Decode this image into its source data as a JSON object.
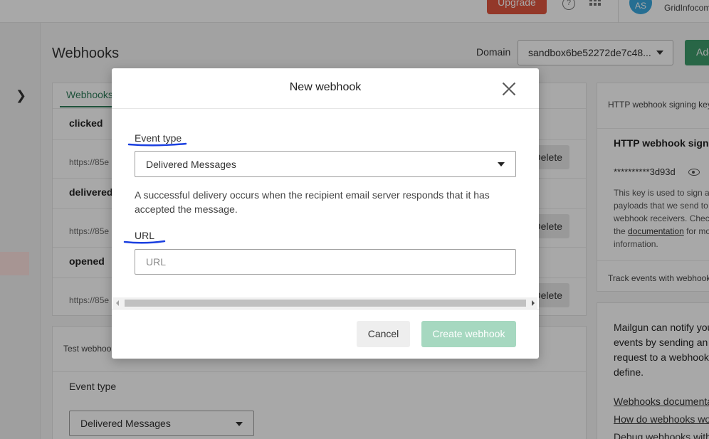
{
  "topbar": {
    "upgrade_label": "Upgrade",
    "help_glyph": "?",
    "avatar_initials": "AS",
    "org_name": "GridInfocom"
  },
  "page": {
    "title": "Webhooks",
    "domain_label": "Domain",
    "domain_value": "sandbox6be52272de7c48...",
    "add_label": "Add"
  },
  "webhooks_card": {
    "tab_label": "Webhooks",
    "events": [
      {
        "name": "clicked",
        "url": "https://85e",
        "delete_label": "Delete"
      },
      {
        "name": "delivered",
        "url": "https://85e",
        "delete_label": "Delete"
      },
      {
        "name": "opened",
        "url": "https://85e",
        "delete_label": "Delete"
      }
    ]
  },
  "test_card": {
    "label": "Test webhook",
    "event_type_label": "Event type",
    "event_type_value": "Delivered Messages"
  },
  "side_panel": {
    "tab_label": "HTTP webhook signing key",
    "title": "HTTP webhook signing key",
    "key_masked": "**********3d93d",
    "desc_line1": "This key is used to sign all",
    "desc_line2": "payloads that we send to",
    "desc_line3": "webhook receivers. Check",
    "desc_the": "the ",
    "desc_link": "documentation",
    "desc_line4_rest": " for more",
    "desc_line5": "information.",
    "track_label": "Track events with webhooks",
    "notify_line1": "Mailgun can notify you of",
    "notify_line2": "events by sending an HTTP",
    "notify_line3": "request to a webhook you",
    "notify_line4": "define.",
    "links": [
      "Webhooks documentation",
      "How do webhooks work?",
      "Debug webhooks with"
    ]
  },
  "modal": {
    "title": "New webhook",
    "event_type_label": "Event type",
    "event_type_value": "Delivered Messages",
    "event_description": "A successful delivery occurs when the recipient email server responds that it has accepted the message.",
    "url_label": "URL",
    "url_placeholder": "URL",
    "url_value": "",
    "cancel_label": "Cancel",
    "create_label": "Create webhook"
  },
  "icons": {
    "close": "close-icon",
    "expand": "chevron-right-icon",
    "dropdown": "caret-down-icon",
    "eye": "eye-icon",
    "apps": "apps-grid-icon",
    "help": "help-icon"
  },
  "colors": {
    "accent_green": "#3d9b6b",
    "disabled_green": "#a6d8c0",
    "upgrade_red": "#e0553f",
    "avatar_blue": "#3aa8de",
    "annotation_blue": "#1a3fe0"
  }
}
